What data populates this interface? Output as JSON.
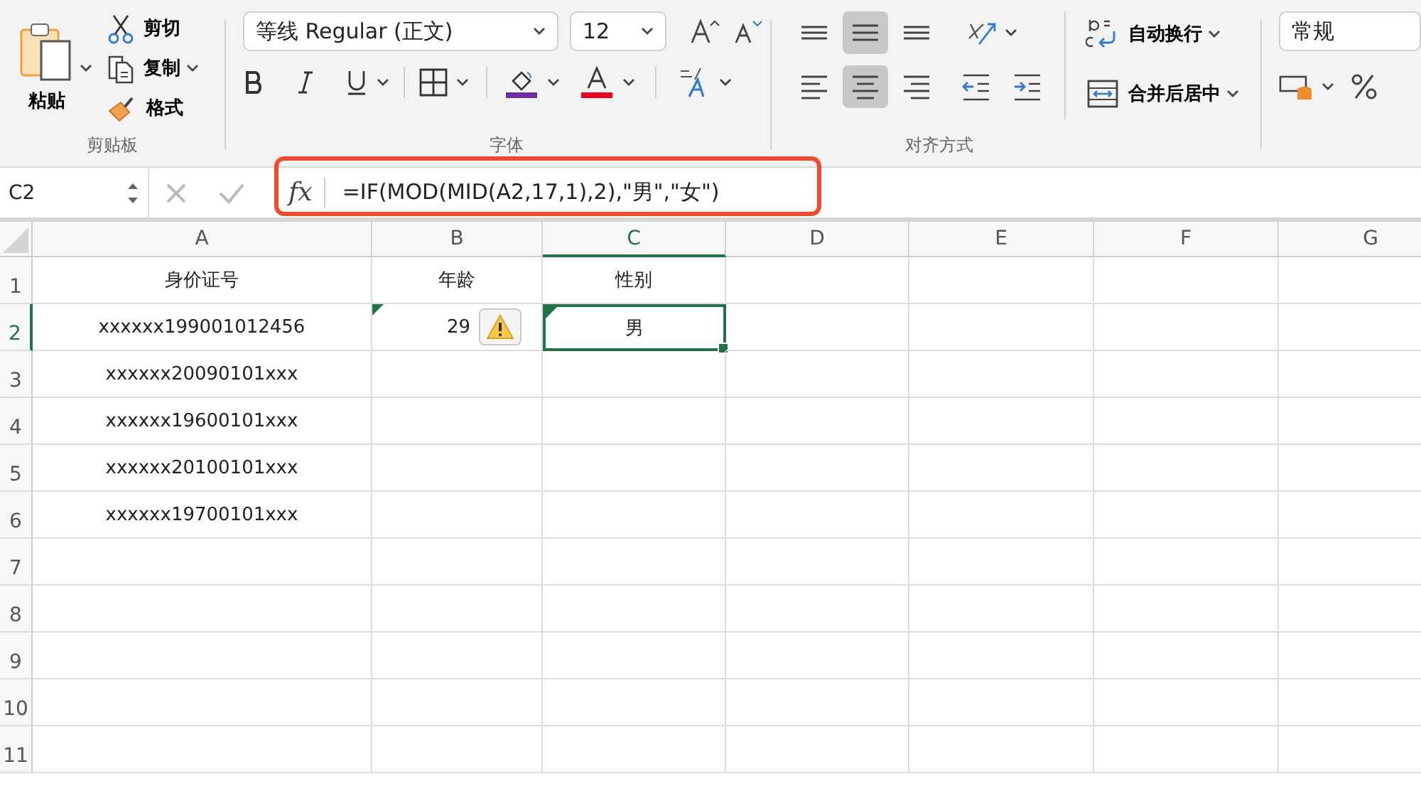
{
  "ribbon": {
    "clipboard": {
      "paste": "粘贴",
      "actions": [
        {
          "kind": "cut",
          "label": "剪切",
          "dropdown": false
        },
        {
          "kind": "copy",
          "label": "复制",
          "dropdown": true
        },
        {
          "kind": "format",
          "label": "格式",
          "dropdown": false
        }
      ],
      "group_label": "剪贴板"
    },
    "font": {
      "name": "等线 Regular (正文)",
      "size": "12",
      "group_label": "字体"
    },
    "alignment": {
      "vertical": [
        {
          "kind": "top",
          "selected": false
        },
        {
          "kind": "middle",
          "selected": true
        },
        {
          "kind": "bottom",
          "selected": false
        }
      ],
      "horizontal": [
        {
          "kind": "left",
          "selected": false
        },
        {
          "kind": "center",
          "selected": true
        },
        {
          "kind": "right",
          "selected": false
        }
      ],
      "wrap_text": "自动换行",
      "merge_center": "合并后居中",
      "group_label": "对齐方式"
    },
    "number": {
      "format": "常规"
    }
  },
  "formula_bar": {
    "name_box": "C2",
    "fx": "fx",
    "formula": "=IF(MOD(MID(A2,17,1),2),\"男\",\"女\")",
    "highlighted": true
  },
  "sheet": {
    "columns": [
      {
        "label": "A",
        "selected": false
      },
      {
        "label": "B",
        "selected": false
      },
      {
        "label": "C",
        "selected": true
      },
      {
        "label": "D",
        "selected": false
      },
      {
        "label": "E",
        "selected": false
      },
      {
        "label": "F",
        "selected": false
      },
      {
        "label": "G",
        "selected": false
      }
    ],
    "rows": [
      {
        "label": "1",
        "selected": false,
        "cells": [
          {
            "kind": "text",
            "text": "身价证号"
          },
          {
            "kind": "text",
            "text": "年龄"
          },
          {
            "kind": "text",
            "text": "性别"
          }
        ]
      },
      {
        "label": "2",
        "selected": true,
        "cells": [
          {
            "kind": "text",
            "text": "xxxxxx199001012456"
          },
          {
            "kind": "number",
            "text": "29",
            "error_flag": true,
            "warning_button": true
          },
          {
            "kind": "text",
            "text": "男",
            "error_flag": true,
            "active": true
          }
        ]
      },
      {
        "label": "3",
        "selected": false,
        "cells": [
          {
            "kind": "text",
            "text": "xxxxxx20090101xxx"
          }
        ]
      },
      {
        "label": "4",
        "selected": false,
        "cells": [
          {
            "kind": "text",
            "text": "xxxxxx19600101xxx"
          }
        ]
      },
      {
        "label": "5",
        "selected": false,
        "cells": [
          {
            "kind": "text",
            "text": "xxxxxx20100101xxx"
          }
        ]
      },
      {
        "label": "6",
        "selected": false,
        "cells": [
          {
            "kind": "text",
            "text": "xxxxxx19700101xxx"
          }
        ]
      },
      {
        "label": "7",
        "selected": false,
        "cells": []
      },
      {
        "label": "8",
        "selected": false,
        "cells": []
      },
      {
        "label": "9",
        "selected": false,
        "cells": []
      },
      {
        "label": "10",
        "selected": false,
        "cells": []
      },
      {
        "label": "11",
        "selected": false,
        "cells": []
      }
    ]
  }
}
